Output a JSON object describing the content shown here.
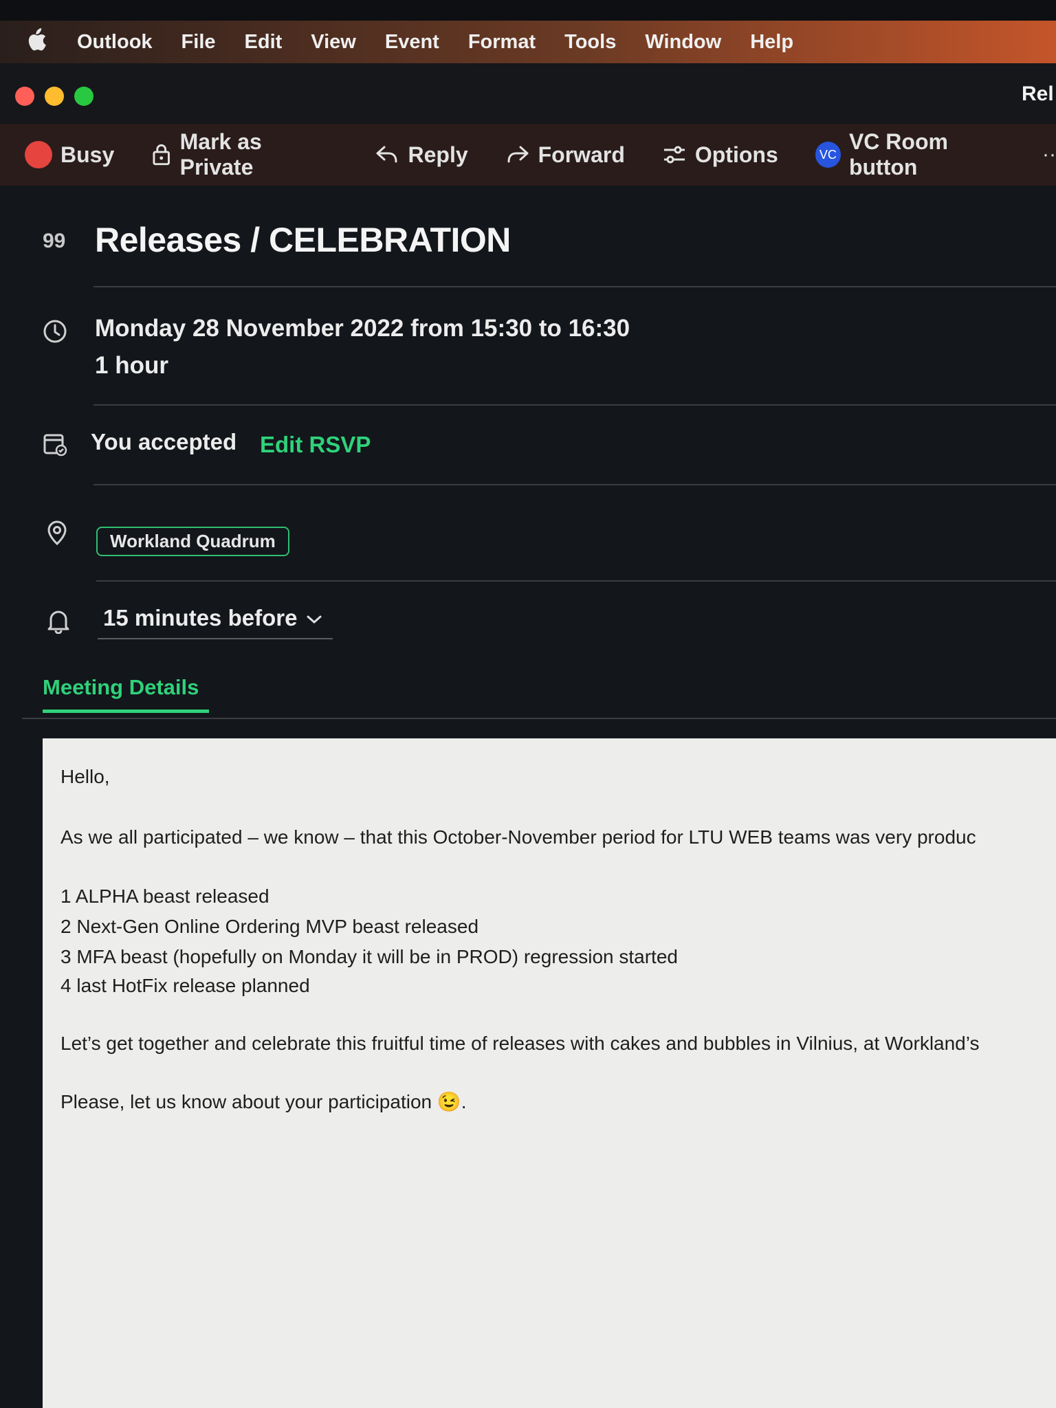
{
  "menubar": {
    "apple_icon": "apple-logo-icon",
    "items": [
      "Outlook",
      "File",
      "Edit",
      "View",
      "Event",
      "Format",
      "Tools",
      "Window",
      "Help"
    ]
  },
  "window": {
    "title_partial": "Rel"
  },
  "toolbar": {
    "busy_label": "Busy",
    "private_label": "Mark as Private",
    "reply_label": "Reply",
    "forward_label": "Forward",
    "options_label": "Options",
    "vc_badge": "VC",
    "vc_label": "VC Room button",
    "more_label": "··"
  },
  "event": {
    "subject_icon_glyph": "99",
    "subject": "Releases / CELEBRATION",
    "date_line": "Monday 28 November 2022 from 15:30 to 16:30",
    "duration": "1 hour",
    "rsvp_status": "You accepted",
    "edit_rsvp": "Edit RSVP",
    "location": "Workland Quadrum",
    "reminder": "15 minutes before"
  },
  "tabs": {
    "active": "Meeting Details"
  },
  "body": {
    "greeting": "Hello,",
    "intro": "As we all participated – we know – that this October-November period for LTU WEB teams was very produc",
    "list": [
      "1 ALPHA beast released",
      "2 Next-Gen Online Ordering MVP beast released",
      "3 MFA beast (hopefully on Monday it will be in PROD) regression started",
      "4 last HotFix release planned"
    ],
    "celebrate": "Let’s get together and celebrate this fruitful time of releases with cakes and bubbles in Vilnius, at Workland’s",
    "closing": "Please, let us know about your participation 😉."
  },
  "colors": {
    "accent_green": "#2fd27a",
    "busy_red": "#e5443f",
    "vc_blue": "#2755e0",
    "menubar_orange": "#c4552a"
  }
}
